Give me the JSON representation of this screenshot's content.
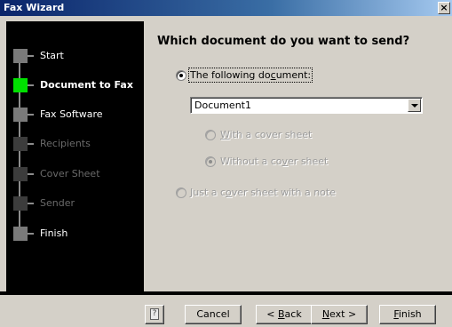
{
  "window": {
    "title": "Fax Wizard",
    "close_glyph": "×"
  },
  "sidebar": {
    "steps": [
      {
        "label": "Start",
        "state": "normal"
      },
      {
        "label": "Document to Fax",
        "state": "active"
      },
      {
        "label": "Fax Software",
        "state": "normal"
      },
      {
        "label": "Recipients",
        "state": "disabled"
      },
      {
        "label": "Cover Sheet",
        "state": "disabled"
      },
      {
        "label": "Sender",
        "state": "disabled"
      },
      {
        "label": "Finish",
        "state": "normal"
      }
    ],
    "active_color": "#00e000"
  },
  "main": {
    "question": "Which document do you want to send?",
    "option_document": {
      "pre": "The following do",
      "u": "c",
      "post": "ument:"
    },
    "document_select": {
      "value": "Document1"
    },
    "option_with_cover": {
      "pre": "",
      "u": "W",
      "post": "ith a cover sheet"
    },
    "option_without_cover": {
      "pre": "Without a co",
      "u": "v",
      "post": "er sheet"
    },
    "option_cover_only": {
      "pre": "Just a c",
      "u": "o",
      "post": "ver sheet with a note"
    }
  },
  "footer": {
    "help_glyph": "?",
    "cancel": "Cancel",
    "back": {
      "pre": "< ",
      "u": "B",
      "post": "ack"
    },
    "next": {
      "pre": "",
      "u": "N",
      "post": "ext >"
    },
    "finish": {
      "pre": "",
      "u": "F",
      "post": "inish"
    }
  }
}
